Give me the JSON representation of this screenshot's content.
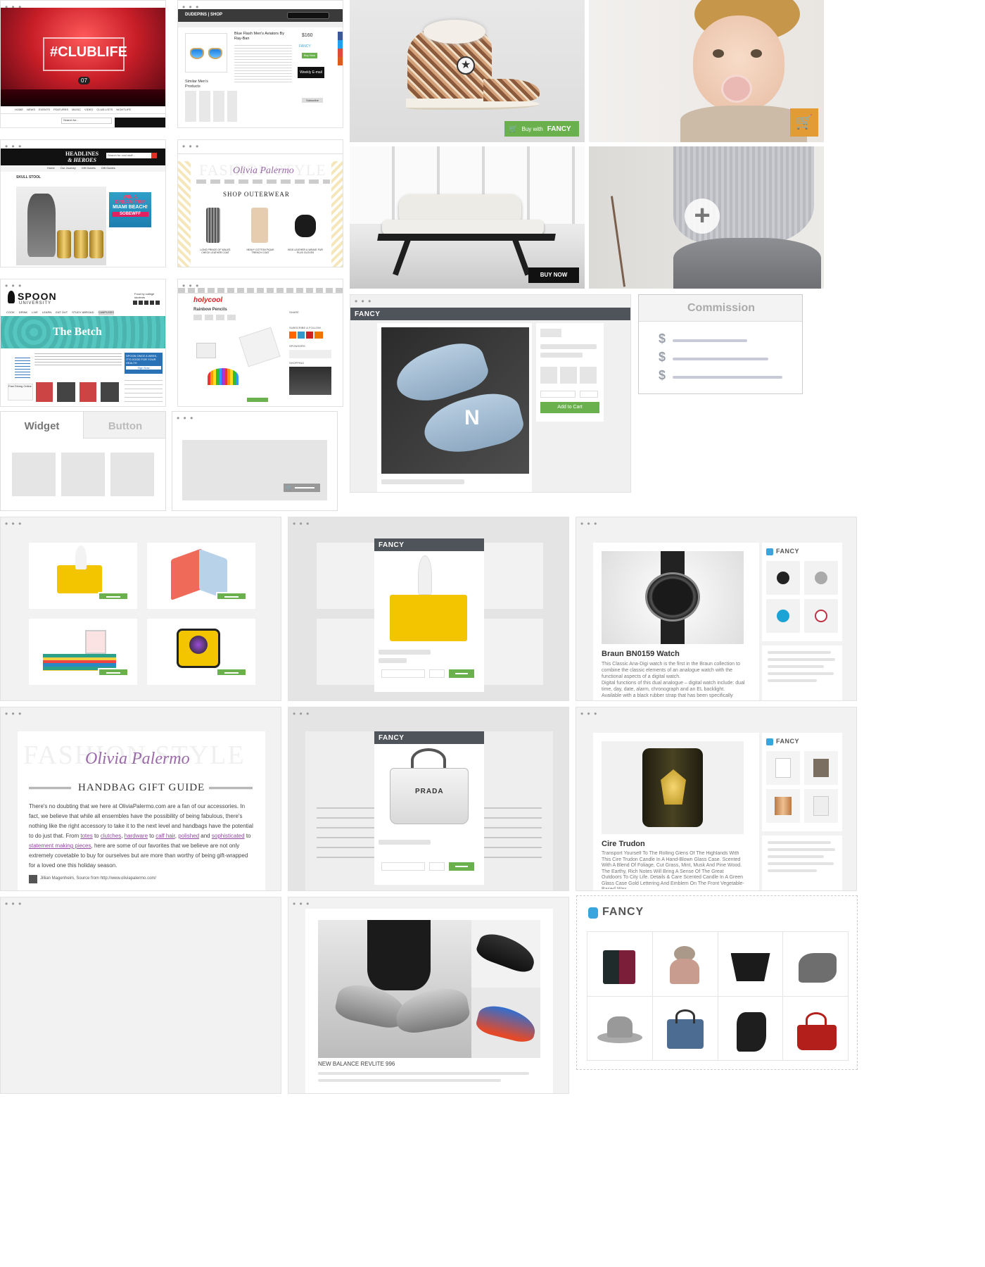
{
  "clublife": {
    "banner_text": "#CLUBLIFE",
    "badge": "07",
    "nav": [
      "HOME",
      "NEWS",
      "EVENTS",
      "FEATURES",
      "MUSIC",
      "VIDEO",
      "CLUB LISTS",
      "NIGHTLIFE"
    ],
    "search_placeholder": "Search for..."
  },
  "dudepins": {
    "logo": "DUDEPINS | SHOP",
    "title": "Blue Flash Men's Aviators By Ray-Ban",
    "price": "$160",
    "fancy_label": "FANCY",
    "buy_label": "Buy Now",
    "similar_title": "Similar Men's Products",
    "newsletter": "Weekly E-mail",
    "subscribe": "Subscribe"
  },
  "converse": {
    "buy_with": "Buy with",
    "fancy": "FANCY"
  },
  "headlines": {
    "logo_line1": "HEADLINES",
    "logo_line2": "& HEROES",
    "search_placeholder": "Search for cool stuff...",
    "nav": [
      "Home",
      "Our Journey",
      "Gift Guides",
      "Gift Guides"
    ],
    "article_title": "SKULL STOOL",
    "ad_text1": "WIN A",
    "ad_text2": "DREAM TRIP",
    "ad_text3": "MIAMI BEACH!",
    "ad_brand": "SOBEWFF"
  },
  "olivia_shop": {
    "logo": "Olivia Palermo",
    "faded": "FASHION STYLE",
    "heading": "SHOP OUTERWEAR",
    "items": [
      "LONG PRINCE OF WALES CHECK LEATHER COAT",
      "HEAVY COTTON PIQUE TRENCH COAT",
      "KIDS LEATHER & WEAVE FUR PLUS GLOVES"
    ]
  },
  "sofa": {
    "buy_now": "BUY NOW"
  },
  "spoon": {
    "logo": "SPOON",
    "logo_sub": "UNIVERSITY",
    "tagline": "Food by college students",
    "nav": [
      "COOK",
      "DRINK",
      "LIVE",
      "LEARN",
      "EAT OUT",
      "STUDY ABROAD",
      "CAMPUSES"
    ],
    "hero": "The Betch",
    "promo_title": "SPOON ONCE A WEEK, IT'S GOOD FOR YOUR HEALTH",
    "promo_btn": "Sign Now",
    "ad": "Fast Dining Online"
  },
  "holycool": {
    "logo": "holycool",
    "title": "Rainbow Pencils",
    "share": "SHARE",
    "subscribe": "SUBSCRIBE & FOLLOW",
    "sponsors": "SPONSORS",
    "shopping": "SHOPPING"
  },
  "fancy_popup": {
    "header": "FANCY",
    "add_to_cart": "Add to Cart"
  },
  "commission": {
    "title": "Commission",
    "symbols": [
      "$",
      "$",
      "$"
    ]
  },
  "widget_tabs": {
    "active": "Widget",
    "inactive": "Button"
  },
  "watch": {
    "fancy": "FANCY",
    "title": "Braun BN0159 Watch",
    "desc": "This Classic Ana-Digi watch is the first in the Braun collection to combine the classic elements of an analogue watch with the functional aspects of a digital watch.",
    "desc2": "Digital functions of this dual analogue – digital watch include: dual time, day, date, alarm, chronograph and an EL backlight. Available with a black rubber strap that has been specifically"
  },
  "mini_header": {
    "fancy": "FANCY"
  },
  "handbag": {
    "logo": "Olivia Palermo",
    "faded": "FASHION STYLE",
    "heading": "HANDBAG GIFT GUIDE",
    "p1": "There's no doubting that we here at OliviaPalermo.com are a fan of our accessories. In fact, we believe that while all ensembles have the possibility of being fabulous, there's nothing like the right accessory to take it to the next level and handbags have the potential to do just that. From",
    "links": [
      "totes",
      "clutches",
      "hardware",
      "calf hair",
      "polished",
      "sophisticated",
      "statement making pieces"
    ],
    "to": "to",
    "and": "and",
    "comma": ",",
    "p2": ", here are some of our favorites that we believe are not only extremely covetable to buy for ourselves but are more than worthy of being gift-wrapped for a loved one this holiday season.",
    "author": "Jillian Magenheim, Source from http://www.oliviapalermo.com/"
  },
  "prada": {
    "header": "FANCY",
    "bag_text": "PRADA"
  },
  "candle": {
    "fancy": "FANCY",
    "title": "Cire Trudon",
    "desc": "Transport Yourself To The Rolling Glens Of The Highlands With This Cire Trudon Candle In A Hand-Blown Glass Case. Scented With A Blend Of Foliage, Cut Grass, Mint, Musk And Pine Wood. The Earthy, Rich Notes Will Bring A Sense Of The Great Outdoors To City Life. Details & Care Scented Candle In A Green Glass Case Gold Lettering And Emblem On The Front Vegetable-Based Wax"
  },
  "newbalance": {
    "caption": "NEW BALANCE REVLITE 996"
  },
  "fancy_grid": {
    "logo": "FANCY",
    "items": [
      "tote-bag",
      "pom-beanie",
      "black-tote",
      "ankle-boot",
      "fedora-hat",
      "blue-tote",
      "studded-boot",
      "red-bag"
    ]
  },
  "colors": {
    "green": "#6ab04c",
    "dark_header": "#4f535a",
    "fancy_blue": "#3aa5dc",
    "cart_orange": "#e39b35",
    "link_purple": "#8f4a9e"
  }
}
